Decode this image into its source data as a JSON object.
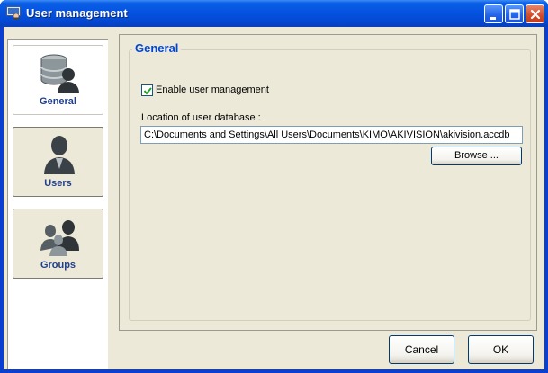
{
  "window": {
    "title": "User management"
  },
  "sidebar": {
    "items": [
      {
        "label": "General",
        "icon": "database-user-icon",
        "selected": true
      },
      {
        "label": "Users",
        "icon": "user-icon",
        "selected": false
      },
      {
        "label": "Groups",
        "icon": "group-icon",
        "selected": false
      }
    ]
  },
  "general": {
    "group_title": "General",
    "enable_label": "Enable user management",
    "enable_checked": true,
    "db_location_label": "Location of user database :",
    "db_location_value": "C:\\Documents and Settings\\All Users\\Documents\\KIMO\\AKIVISION\\akivision.accdb",
    "browse_label": "Browse ..."
  },
  "footer": {
    "cancel_label": "Cancel",
    "ok_label": "OK"
  },
  "colors": {
    "titlebar": "#0553e0",
    "group_title": "#0046d5",
    "nav_label": "#1f3f8f",
    "dialog_bg": "#ece9d8"
  }
}
